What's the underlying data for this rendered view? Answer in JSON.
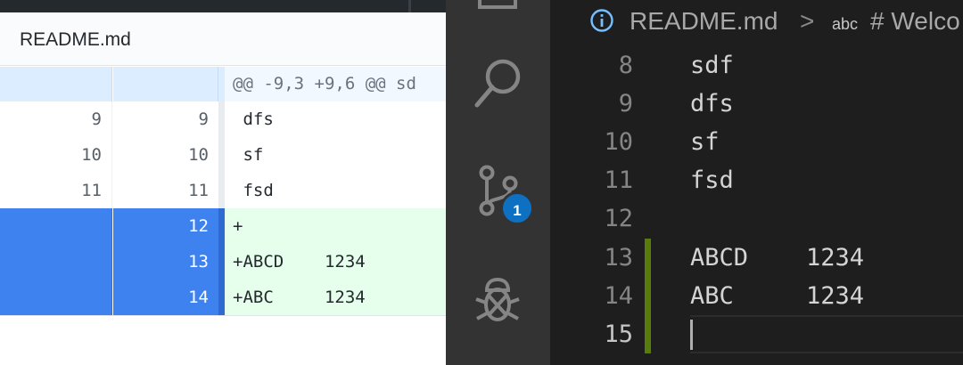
{
  "diff": {
    "file_name": "README.md",
    "hunk_header": "@@ -9,3 +9,6 @@ sd",
    "rows": [
      {
        "type": "context",
        "old": "9",
        "new": "9",
        "code": " dfs"
      },
      {
        "type": "context",
        "old": "10",
        "new": "10",
        "code": " sf"
      },
      {
        "type": "context",
        "old": "11",
        "new": "11",
        "code": " fsd"
      },
      {
        "type": "add",
        "old": "",
        "new": "12",
        "code": "+"
      },
      {
        "type": "add",
        "old": "",
        "new": "13",
        "code": "+ABCD    1234"
      },
      {
        "type": "add",
        "old": "",
        "new": "14",
        "code": "+ABC     1234"
      }
    ],
    "colors": {
      "added_bg": "#e6ffed",
      "selected_line_number": "#3e82f0",
      "hunk_bg": "#f1f8ff"
    }
  },
  "vscode": {
    "activity_bar": {
      "icons": [
        "explorer-icon",
        "search-icon",
        "source-control-icon",
        "debug-icon"
      ],
      "source_control_badge": "1",
      "badge_color": "#0e70c0"
    },
    "breadcrumb": {
      "icon": "info-icon",
      "file": "README.md",
      "separator": ">",
      "symbol_kind": "abc",
      "symbol": "# Welco"
    },
    "editor": {
      "lines": [
        {
          "num": "8",
          "text": "sdf",
          "changed": false
        },
        {
          "num": "9",
          "text": "dfs",
          "changed": false
        },
        {
          "num": "10",
          "text": "sf",
          "changed": false
        },
        {
          "num": "11",
          "text": "fsd",
          "changed": false
        },
        {
          "num": "12",
          "text": "",
          "changed": false
        },
        {
          "num": "13",
          "text": "ABCD    1234",
          "changed": true
        },
        {
          "num": "14",
          "text": "ABC     1234",
          "changed": true
        },
        {
          "num": "15",
          "text": "",
          "changed": true,
          "current": true
        }
      ],
      "colors": {
        "added_gutter": "#587c0c",
        "background": "#1e1e1e"
      }
    }
  }
}
